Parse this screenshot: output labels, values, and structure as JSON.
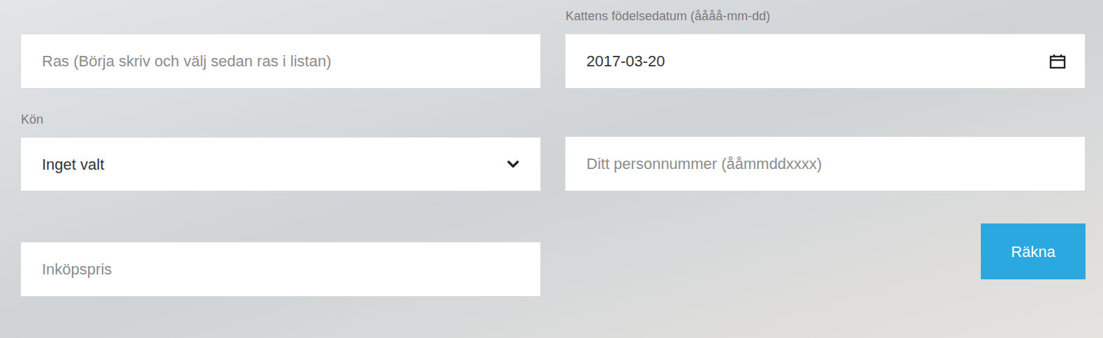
{
  "breed": {
    "placeholder": "Ras (Börja skriv och välj sedan ras i listan)"
  },
  "birthdate": {
    "label": "Kattens födelsedatum (åååå-mm-dd)",
    "value": "2017-03-20"
  },
  "gender": {
    "label": "Kön",
    "value": "Inget valt"
  },
  "personal_number": {
    "placeholder": "Ditt personnummer (ååmmddxxxx)"
  },
  "purchase_price": {
    "placeholder": "Inköpspris"
  },
  "buttons": [
    "Räkna"
  ]
}
